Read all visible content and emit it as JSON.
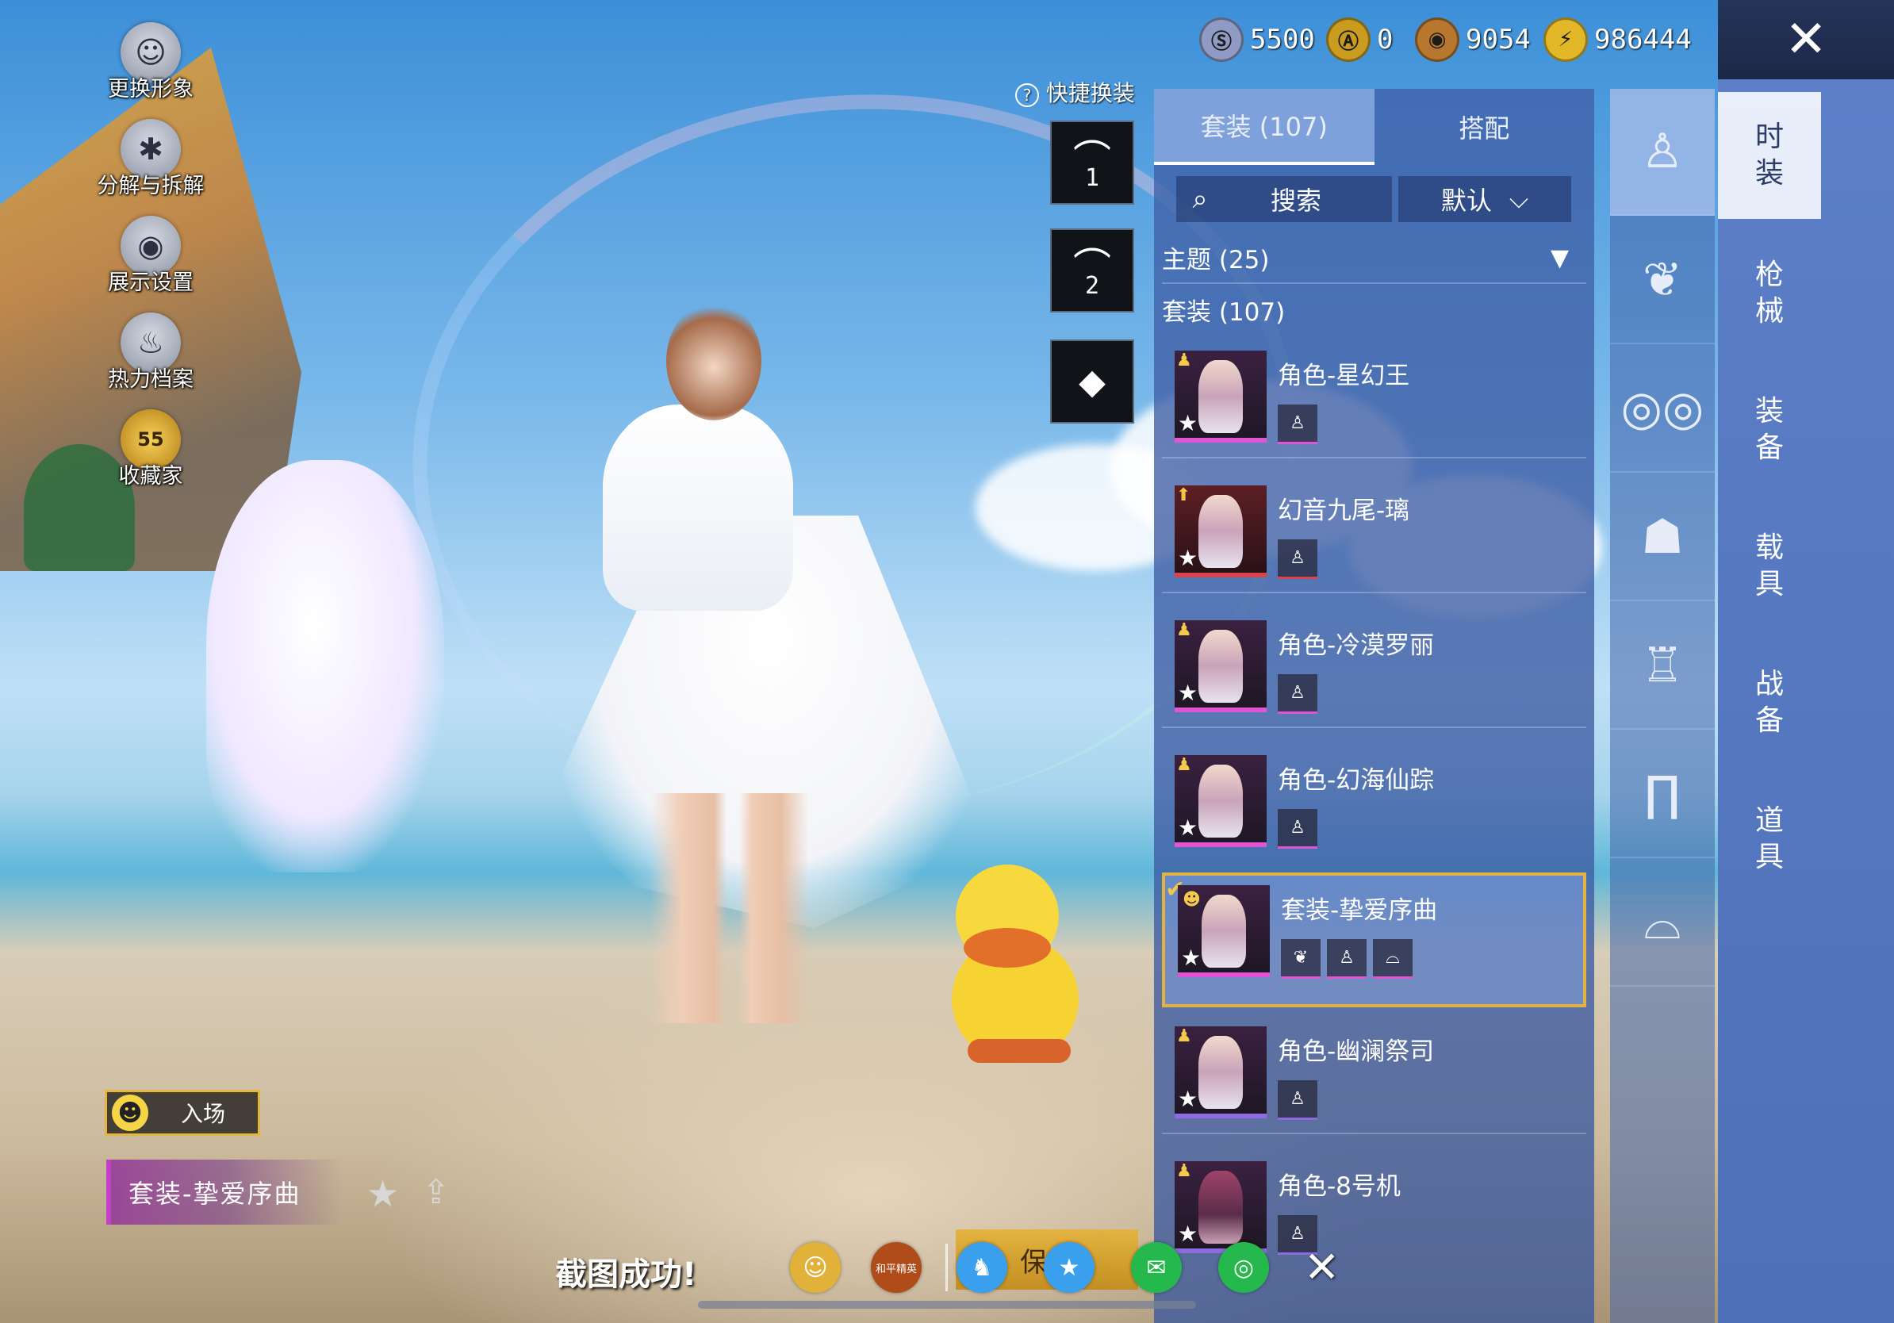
{
  "currency": [
    {
      "icon": "silver-coin-icon",
      "symbol": "Ⓢ",
      "value": "5500",
      "color": "#8f9bc4"
    },
    {
      "icon": "gold-token-icon",
      "symbol": "Ⓐ",
      "value": "0",
      "color": "#c99b1f"
    },
    {
      "icon": "bronze-coin-icon",
      "symbol": "◉",
      "value": "9054",
      "color": "#b7772f"
    },
    {
      "icon": "lightning-coin-icon",
      "symbol": "⚡",
      "value": "986444",
      "color": "#e2b828"
    }
  ],
  "left_menu": [
    {
      "name": "change-avatar",
      "icon": "☺",
      "label": "更换形象"
    },
    {
      "name": "decompose",
      "icon": "✱",
      "label": "分解与拆解"
    },
    {
      "name": "display-settings",
      "icon": "◉",
      "label": "展示设置"
    },
    {
      "name": "heat-archive",
      "icon": "♨",
      "label": "热力档案"
    },
    {
      "name": "collector",
      "icon": "55",
      "label": "收藏家"
    }
  ],
  "entrance": {
    "label": "入场",
    "icon": "☻"
  },
  "current_suit": {
    "label": "套装-挚爱序曲"
  },
  "quick_change": {
    "title": "快捷换装",
    "help_icon": "?",
    "slots": [
      {
        "num": "1"
      },
      {
        "num": "2"
      }
    ],
    "diamond": "◆"
  },
  "tabs": [
    {
      "label": "套装 (107)",
      "active": true
    },
    {
      "label": "搭配",
      "active": false
    }
  ],
  "search": {
    "label": "搜索",
    "icon": "⌕"
  },
  "sort": {
    "label": "默认",
    "caret": "⌵"
  },
  "sections": {
    "theme": "主题 (25)",
    "suits": "套装 (107)",
    "caret": "▼"
  },
  "items": [
    {
      "title": "角色-星幻王"
    },
    {
      "title": "幻音九尾-璃"
    },
    {
      "title": "角色-冷漠罗丽"
    },
    {
      "title": "角色-幻海仙踪"
    },
    {
      "title": "套装-挚爱序曲"
    },
    {
      "title": "角色-幽澜祭司"
    },
    {
      "title": "角色-8号机"
    }
  ],
  "icon_categories": [
    "outfit-icon",
    "hair-icon",
    "glasses-icon",
    "mask-icon",
    "clothes-icon",
    "pants-icon",
    "shoes-icon"
  ],
  "text_categories": [
    {
      "l1": "时",
      "l2": "装"
    },
    {
      "l1": "枪",
      "l2": "械"
    },
    {
      "l1": "装",
      "l2": "备"
    },
    {
      "l1": "载",
      "l2": "具"
    },
    {
      "l1": "战",
      "l2": "备"
    },
    {
      "l1": "道",
      "l2": "具"
    }
  ],
  "share_bar": {
    "message": "截图成功!",
    "save_label": "保存",
    "icons": [
      {
        "name": "user-share-icon",
        "glyph": "☺",
        "color": "#e2b13a"
      },
      {
        "name": "game-logo-icon",
        "glyph": "和平精英",
        "color": "#b04b1a"
      },
      {
        "name": "qq-icon",
        "glyph": "♞",
        "color": "#3aa0ee"
      },
      {
        "name": "qzone-icon",
        "glyph": "★",
        "color": "#3aa0ee"
      },
      {
        "name": "wechat-icon",
        "glyph": "✉",
        "color": "#25b84c"
      },
      {
        "name": "moments-icon",
        "glyph": "◎",
        "color": "#25b84c"
      }
    ]
  },
  "close_glyph": "✕"
}
